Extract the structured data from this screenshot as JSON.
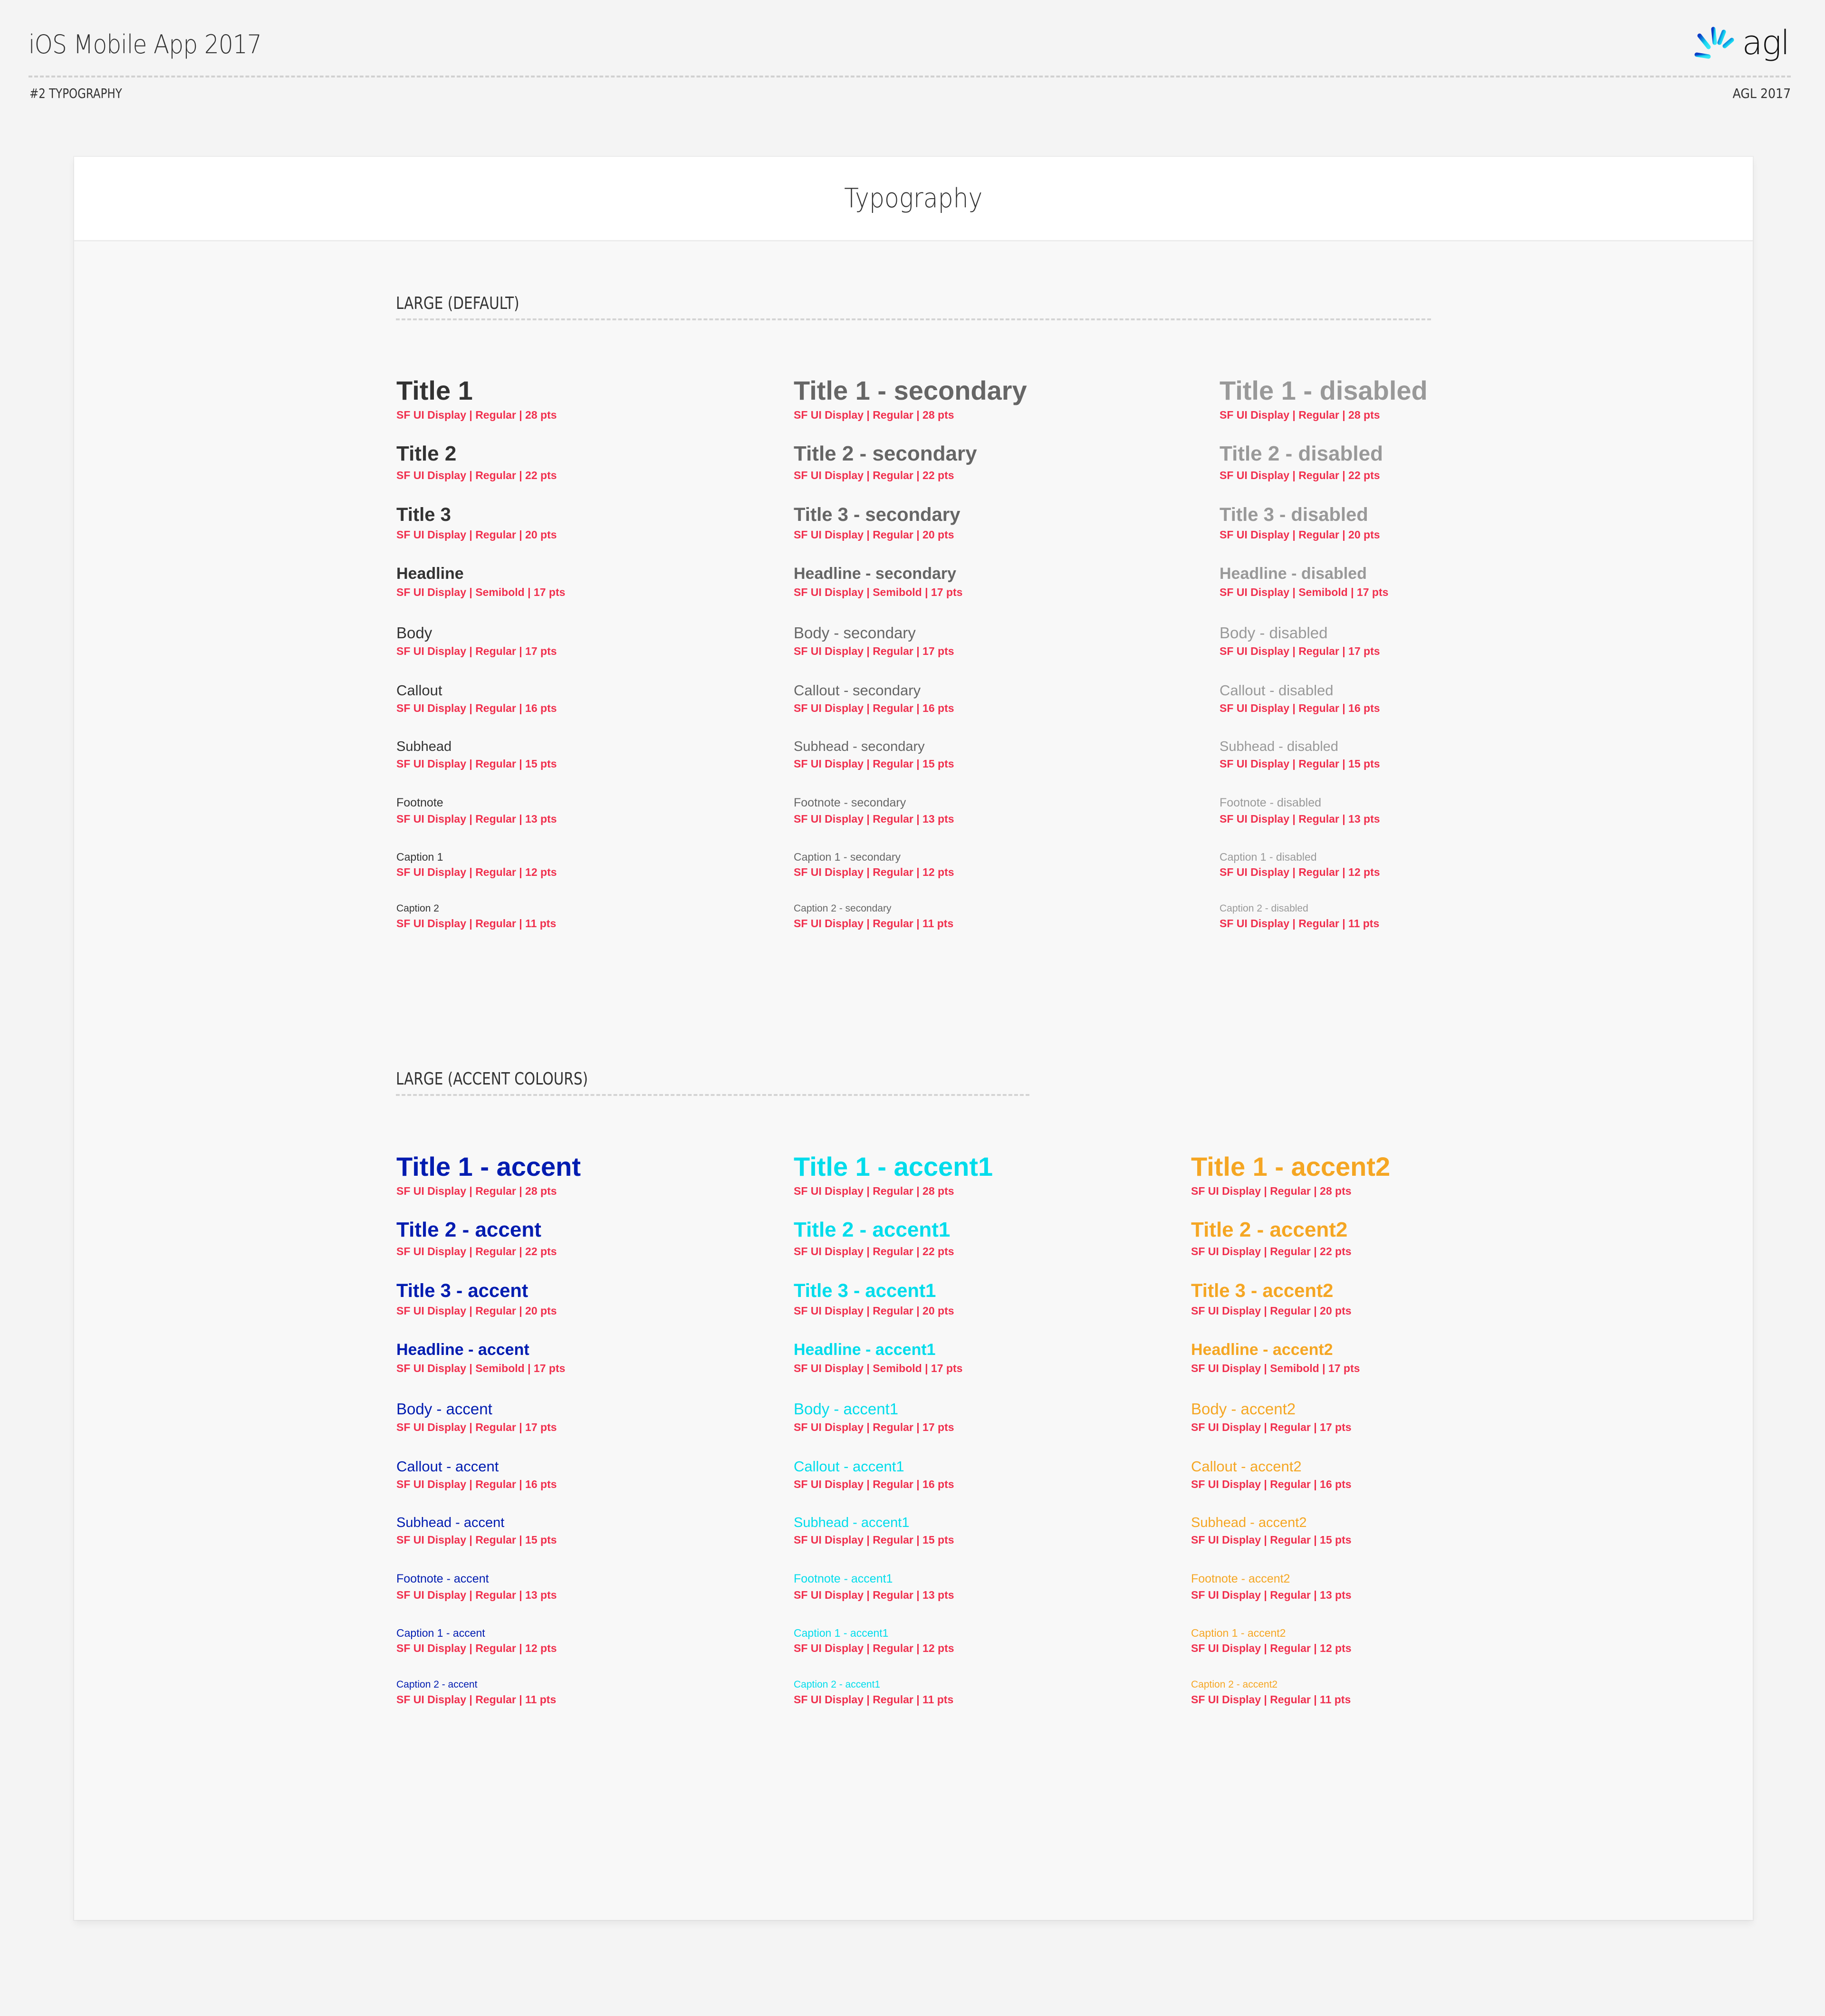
{
  "header": {
    "title": "iOS Mobile App 2017",
    "section": "#2 TYPOGRAPHY",
    "meta": "AGL 2017",
    "logo_text": "agl",
    "logo_icon": "agl-sunburst-logo-icon"
  },
  "card": {
    "title": "Typography"
  },
  "colors": {
    "primary": "#333333",
    "secondary": "#666666",
    "disabled": "#999999",
    "accent": "#001cb0",
    "accent1": "#00dceb",
    "accent2": "#f5a623",
    "spec": "#f0304e",
    "page_bg": "#f4f4f4",
    "card_bg": "#f8f8f8"
  },
  "sections": [
    {
      "label": "LARGE (DEFAULT)",
      "columns": [
        {
          "variant": "primary",
          "items": [
            {
              "name": "Title 1",
              "spec": "SF UI Display | Regular | 28 pts"
            },
            {
              "name": "Title 2",
              "spec": "SF UI Display | Regular | 22 pts"
            },
            {
              "name": "Title 3",
              "spec": "SF UI Display | Regular | 20 pts"
            },
            {
              "name": "Headline",
              "spec": "SF UI Display | Semibold | 17 pts"
            },
            {
              "name": "Body",
              "spec": "SF UI Display | Regular | 17 pts"
            },
            {
              "name": "Callout",
              "spec": "SF UI Display | Regular | 16 pts"
            },
            {
              "name": "Subhead",
              "spec": "SF UI Display | Regular | 15 pts"
            },
            {
              "name": "Footnote",
              "spec": "SF UI Display | Regular | 13 pts"
            },
            {
              "name": "Caption 1",
              "spec": "SF UI Display | Regular | 12 pts"
            },
            {
              "name": "Caption 2",
              "spec": "SF UI Display | Regular | 11 pts"
            }
          ]
        },
        {
          "variant": "secondary",
          "items": [
            {
              "name": "Title 1 - secondary",
              "spec": "SF UI Display | Regular | 28 pts"
            },
            {
              "name": "Title 2 - secondary",
              "spec": "SF UI Display | Regular | 22 pts"
            },
            {
              "name": "Title 3 - secondary",
              "spec": "SF UI Display | Regular | 20 pts"
            },
            {
              "name": "Headline - secondary",
              "spec": "SF UI Display | Semibold | 17 pts"
            },
            {
              "name": "Body - secondary",
              "spec": "SF UI Display | Regular | 17 pts"
            },
            {
              "name": "Callout - secondary",
              "spec": "SF UI Display | Regular | 16 pts"
            },
            {
              "name": "Subhead - secondary",
              "spec": "SF UI Display | Regular | 15 pts"
            },
            {
              "name": "Footnote - secondary",
              "spec": "SF UI Display | Regular | 13 pts"
            },
            {
              "name": "Caption 1 - secondary",
              "spec": "SF UI Display | Regular | 12 pts"
            },
            {
              "name": "Caption 2 - secondary",
              "spec": "SF UI Display | Regular | 11 pts"
            }
          ]
        },
        {
          "variant": "disabled",
          "items": [
            {
              "name": "Title 1 - disabled",
              "spec": "SF UI Display | Regular | 28 pts"
            },
            {
              "name": "Title 2 - disabled",
              "spec": "SF UI Display | Regular | 22 pts"
            },
            {
              "name": "Title 3 - disabled",
              "spec": "SF UI Display | Regular | 20 pts"
            },
            {
              "name": "Headline - disabled",
              "spec": "SF UI Display | Semibold | 17 pts"
            },
            {
              "name": "Body - disabled",
              "spec": "SF UI Display | Regular | 17 pts"
            },
            {
              "name": "Callout - disabled",
              "spec": "SF UI Display | Regular | 16 pts"
            },
            {
              "name": "Subhead - disabled",
              "spec": "SF UI Display | Regular | 15 pts"
            },
            {
              "name": "Footnote - disabled",
              "spec": "SF UI Display | Regular | 13 pts"
            },
            {
              "name": "Caption 1 - disabled",
              "spec": "SF UI Display | Regular | 12 pts"
            },
            {
              "name": "Caption 2 - disabled",
              "spec": "SF UI Display | Regular | 11 pts"
            }
          ]
        }
      ]
    },
    {
      "label": "LARGE (ACCENT COLOURS)",
      "columns": [
        {
          "variant": "accent",
          "items": [
            {
              "name": "Title 1 - accent",
              "spec": "SF UI Display | Regular | 28 pts"
            },
            {
              "name": "Title 2 - accent",
              "spec": "SF UI Display | Regular | 22 pts"
            },
            {
              "name": "Title 3 - accent",
              "spec": "SF UI Display | Regular | 20 pts"
            },
            {
              "name": "Headline - accent",
              "spec": "SF UI Display | Semibold | 17 pts"
            },
            {
              "name": "Body - accent",
              "spec": "SF UI Display | Regular | 17 pts"
            },
            {
              "name": "Callout - accent",
              "spec": "SF UI Display | Regular | 16 pts"
            },
            {
              "name": "Subhead - accent",
              "spec": "SF UI Display | Regular | 15 pts"
            },
            {
              "name": "Footnote - accent",
              "spec": "SF UI Display | Regular | 13 pts"
            },
            {
              "name": "Caption 1 - accent",
              "spec": "SF UI Display | Regular | 12 pts"
            },
            {
              "name": "Caption 2 - accent",
              "spec": "SF UI Display | Regular | 11 pts"
            }
          ]
        },
        {
          "variant": "accent1",
          "items": [
            {
              "name": "Title 1 - accent1",
              "spec": "SF UI Display | Regular | 28 pts"
            },
            {
              "name": "Title 2 - accent1",
              "spec": "SF UI Display | Regular | 22 pts"
            },
            {
              "name": "Title 3 - accent1",
              "spec": "SF UI Display | Regular | 20 pts"
            },
            {
              "name": "Headline - accent1",
              "spec": "SF UI Display | Semibold | 17 pts"
            },
            {
              "name": "Body - accent1",
              "spec": "SF UI Display | Regular | 17 pts"
            },
            {
              "name": "Callout - accent1",
              "spec": "SF UI Display | Regular | 16 pts"
            },
            {
              "name": "Subhead - accent1",
              "spec": "SF UI Display | Regular | 15 pts"
            },
            {
              "name": "Footnote - accent1",
              "spec": "SF UI Display | Regular | 13 pts"
            },
            {
              "name": "Caption 1 - accent1",
              "spec": "SF UI Display | Regular | 12 pts"
            },
            {
              "name": "Caption 2 - accent1",
              "spec": "SF UI Display | Regular | 11 pts"
            }
          ]
        },
        {
          "variant": "accent2",
          "items": [
            {
              "name": "Title 1 - accent2",
              "spec": "SF UI Display | Regular | 28 pts"
            },
            {
              "name": "Title 2 - accent2",
              "spec": "SF UI Display | Regular | 22 pts"
            },
            {
              "name": "Title 3 - accent2",
              "spec": "SF UI Display | Regular | 20 pts"
            },
            {
              "name": "Headline - accent2",
              "spec": "SF UI Display | Semibold | 17 pts"
            },
            {
              "name": "Body - accent2",
              "spec": "SF UI Display | Regular | 17 pts"
            },
            {
              "name": "Callout - accent2",
              "spec": "SF UI Display | Regular | 16 pts"
            },
            {
              "name": "Subhead - accent2",
              "spec": "SF UI Display | Regular | 15 pts"
            },
            {
              "name": "Footnote - accent2",
              "spec": "SF UI Display | Regular | 13 pts"
            },
            {
              "name": "Caption 1 - accent2",
              "spec": "SF UI Display | Regular | 12 pts"
            },
            {
              "name": "Caption 2 - accent2",
              "spec": "SF UI Display | Regular | 11 pts"
            }
          ]
        }
      ]
    }
  ]
}
